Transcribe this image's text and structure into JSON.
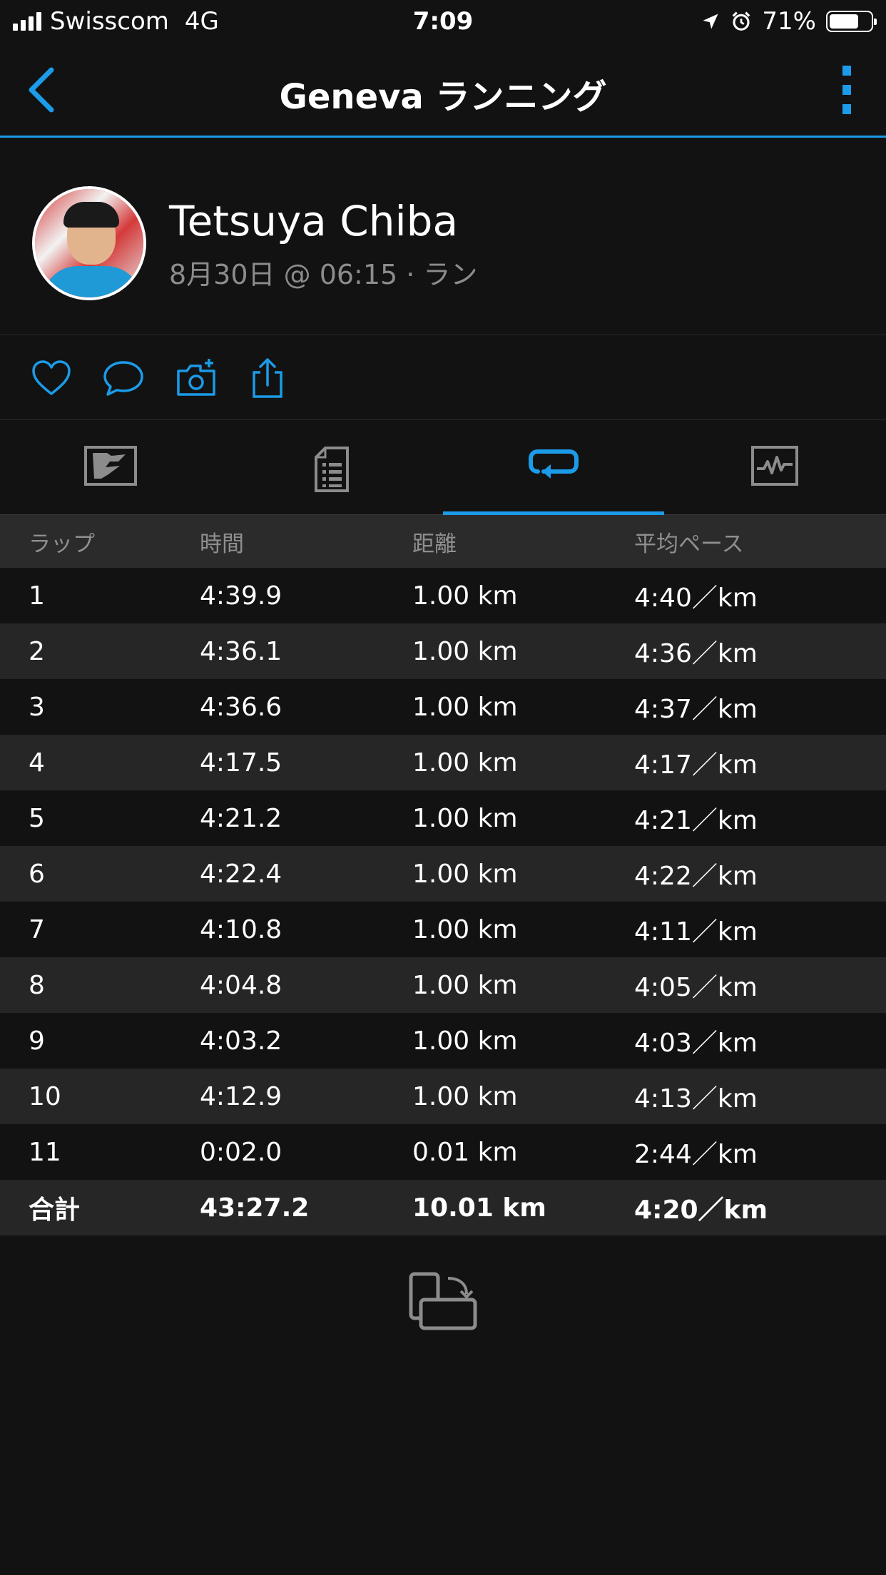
{
  "status_bar": {
    "carrier": "Swisscom",
    "network": "4G",
    "time": "7:09",
    "battery": "71%",
    "battery_level": 0.71
  },
  "nav": {
    "title": "Geneva ランニング",
    "back_icon": "chevron-left-icon",
    "more_icon": "more-vertical-icon"
  },
  "activity": {
    "user_name": "Tetsuya Chiba",
    "meta": "8月30日 @ 06:15 · ラン"
  },
  "actions": [
    "like-icon",
    "comment-icon",
    "add-photo-icon",
    "share-icon"
  ],
  "tabs": [
    {
      "icon": "map-icon",
      "active": false
    },
    {
      "icon": "summary-icon",
      "active": false
    },
    {
      "icon": "laps-icon",
      "active": true
    },
    {
      "icon": "chart-icon",
      "active": false
    }
  ],
  "laps": {
    "headers": [
      "ラップ",
      "時間",
      "距離",
      "平均ペース"
    ],
    "rows": [
      [
        "1",
        "4:39.9",
        "1.00 km",
        "4:40／km"
      ],
      [
        "2",
        "4:36.1",
        "1.00 km",
        "4:36／km"
      ],
      [
        "3",
        "4:36.6",
        "1.00 km",
        "4:37／km"
      ],
      [
        "4",
        "4:17.5",
        "1.00 km",
        "4:17／km"
      ],
      [
        "5",
        "4:21.2",
        "1.00 km",
        "4:21／km"
      ],
      [
        "6",
        "4:22.4",
        "1.00 km",
        "4:22／km"
      ],
      [
        "7",
        "4:10.8",
        "1.00 km",
        "4:11／km"
      ],
      [
        "8",
        "4:04.8",
        "1.00 km",
        "4:05／km"
      ],
      [
        "9",
        "4:03.2",
        "1.00 km",
        "4:03／km"
      ],
      [
        "10",
        "4:12.9",
        "1.00 km",
        "4:13／km"
      ],
      [
        "11",
        "0:02.0",
        "0.01 km",
        "2:44／km"
      ]
    ],
    "total": [
      "合計",
      "43:27.2",
      "10.01 km",
      "4:20／km"
    ]
  },
  "colors": {
    "accent": "#1b9be8",
    "background": "#121212",
    "row_alt": "#262626",
    "muted_text": "#8c8c8c"
  }
}
